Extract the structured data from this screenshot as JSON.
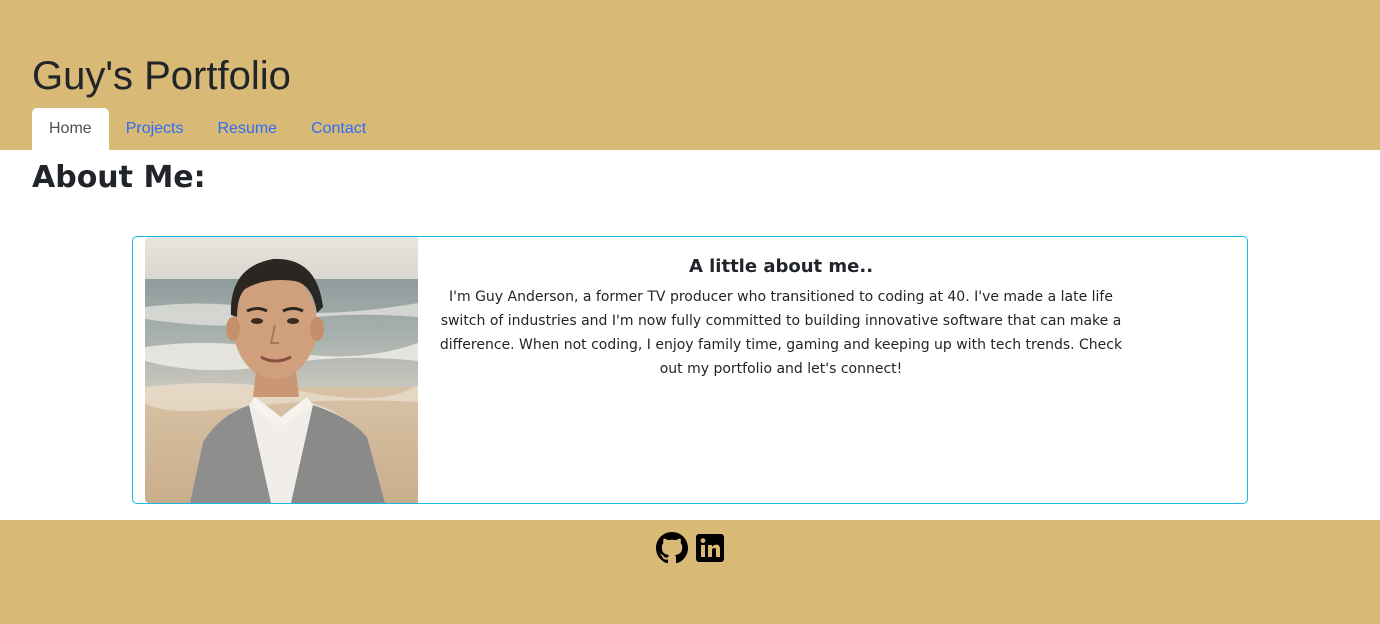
{
  "header": {
    "title": "Guy's Portfolio",
    "nav": [
      {
        "label": "Home",
        "active": true
      },
      {
        "label": "Projects",
        "active": false
      },
      {
        "label": "Resume",
        "active": false
      },
      {
        "label": "Contact",
        "active": false
      }
    ]
  },
  "main": {
    "heading": "About Me:",
    "card": {
      "image": "profile-photo",
      "title": "A little about me..",
      "text": "I'm Guy Anderson, a former TV producer who transitioned to coding at 40. I've made a late life switch of industries and I'm now fully committed to building innovative software that can make a difference. When not coding, I enjoy family time, gaming and keeping up with tech trends. Check out my portfolio and let's connect!"
    }
  },
  "footer": {
    "icons": [
      "github-icon",
      "linkedin-icon"
    ]
  },
  "colors": {
    "header_bg": "#d8b976",
    "footer_bg": "#d8b976",
    "nav_link": "#2f6df6",
    "card_border": "#1ab8e6"
  }
}
